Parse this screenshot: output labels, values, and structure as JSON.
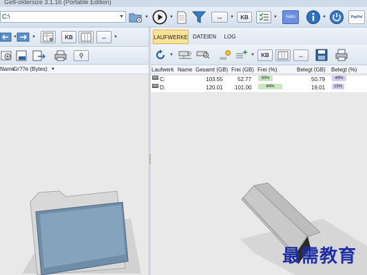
{
  "window": {
    "title": "GetFoldersize 3.1.16 (Portable Edition)"
  },
  "path": {
    "value": "C:\\"
  },
  "toolbar": {
    "kb_label": "KB",
    "hello_label": "Hello",
    "paypal_label": "PayPal"
  },
  "left": {
    "kb_label": "KB",
    "columns": [
      "Name",
      "Gr??e (Bytes)"
    ]
  },
  "tabs": [
    {
      "label": "LAUFWERKE",
      "active": true
    },
    {
      "label": "DATEIEN",
      "active": false
    },
    {
      "label": "LOG",
      "active": false
    }
  ],
  "right": {
    "kb_label": "KB",
    "columns": [
      "Laufwerk",
      "Name",
      "Gesamt (GB)",
      "Frei (GB)",
      "Frei (%)",
      "Belegt (GB)",
      "Belegt (%)"
    ],
    "rows": [
      {
        "drive": "C:",
        "name": "",
        "total": "103.55",
        "free": "52.77",
        "free_pct": "50%",
        "free_pct_value": 50,
        "used": "50.79",
        "used_pct": "49%",
        "used_pct_value": 49
      },
      {
        "drive": "D:",
        "name": "",
        "total": "120.01",
        "free": "101.00",
        "free_pct": "84%",
        "free_pct_value": 84,
        "used": "19.01",
        "used_pct": "15%",
        "used_pct_value": 15
      }
    ]
  },
  "watermark": {
    "text": "最需教育"
  },
  "colors": {
    "free_bar": "#c8e6c0",
    "used_bar": "#d4ccf4",
    "active_tab": "#fbe29a",
    "accent": "#2b5e9e"
  }
}
